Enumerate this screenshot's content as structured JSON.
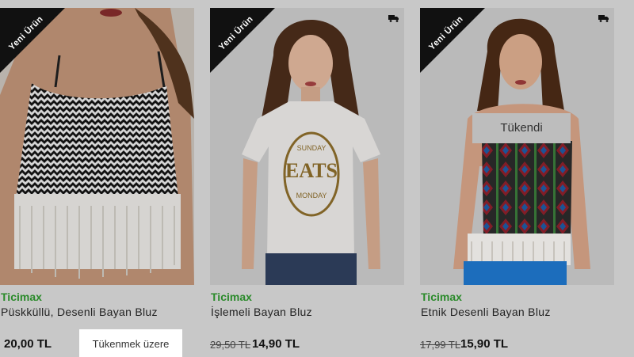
{
  "colors": {
    "brand_green": "#2a8a2a",
    "background_overlay": "#c8c8c8",
    "badge_black": "#111111"
  },
  "products": [
    {
      "badge": "Yeni Ürün",
      "brand": "Ticimax",
      "name": "Püskküllü, Desenli Bayan Bluz",
      "old_price": "",
      "price": "20,00 TL",
      "stock_label": "Tükenmek üzere",
      "overlay_label": "",
      "icons": []
    },
    {
      "badge": "Yeni Ürün",
      "brand": "Ticimax",
      "name": "İşlemeli Bayan Bluz",
      "old_price": "29,50 TL",
      "price": "14,90 TL",
      "stock_label": "",
      "overlay_label": "",
      "icons": [
        "truck-icon"
      ]
    },
    {
      "badge": "Yeni Ürün",
      "brand": "Ticimax",
      "name": "Etnik Desenli Bayan Bluz",
      "old_price": "17,99 TL",
      "price": "15,90 TL",
      "stock_label": "",
      "overlay_label": "Tükendi",
      "icons": [
        "truck-icon"
      ]
    }
  ],
  "shirt_print": {
    "line1": "SUNDAY",
    "line2": "EATS",
    "line3": "MONDAY"
  }
}
